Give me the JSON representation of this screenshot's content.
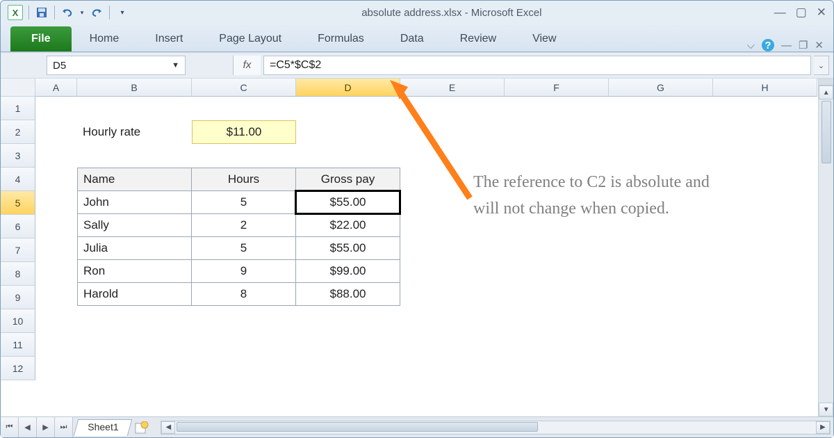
{
  "window": {
    "title": "absolute address.xlsx - Microsoft Excel"
  },
  "ribbon": {
    "file": "File",
    "tabs": [
      "Home",
      "Insert",
      "Page Layout",
      "Formulas",
      "Data",
      "Review",
      "View"
    ]
  },
  "namebox": "D5",
  "fx_label": "fx",
  "formula": "=C5*$C$2",
  "columns": [
    "A",
    "B",
    "C",
    "D",
    "E",
    "F",
    "G",
    "H"
  ],
  "rows": [
    "1",
    "2",
    "3",
    "4",
    "5",
    "6",
    "7",
    "8",
    "9",
    "10",
    "11",
    "12"
  ],
  "selected_col": "D",
  "selected_row": "5",
  "sheet": {
    "hourly_rate_label": "Hourly rate",
    "hourly_rate_value": "$11.00",
    "headers": {
      "name": "Name",
      "hours": "Hours",
      "gross": "Gross pay"
    },
    "data": [
      {
        "name": "John",
        "hours": "5",
        "gross": "$55.00"
      },
      {
        "name": "Sally",
        "hours": "2",
        "gross": "$22.00"
      },
      {
        "name": "Julia",
        "hours": "5",
        "gross": "$55.00"
      },
      {
        "name": "Ron",
        "hours": "9",
        "gross": "$99.00"
      },
      {
        "name": "Harold",
        "hours": "8",
        "gross": "$88.00"
      }
    ]
  },
  "annotation": "The reference to C2 is absolute and will not change when copied.",
  "sheet_tab": "Sheet1"
}
